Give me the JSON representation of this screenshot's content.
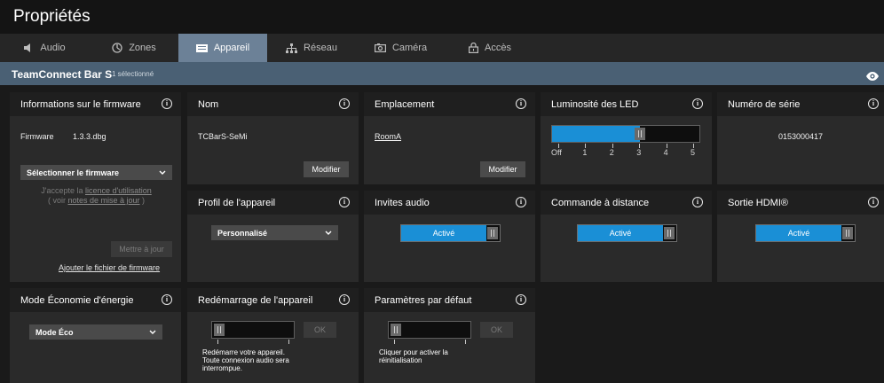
{
  "window": {
    "title": "Propriétés"
  },
  "tabs": [
    {
      "label": "Audio",
      "icon": "speaker-icon"
    },
    {
      "label": "Zones",
      "icon": "zones-icon"
    },
    {
      "label": "Appareil",
      "icon": "device-icon",
      "active": true
    },
    {
      "label": "Réseau",
      "icon": "network-icon"
    },
    {
      "label": "Caméra",
      "icon": "camera-icon"
    },
    {
      "label": "Accès",
      "icon": "lock-icon"
    }
  ],
  "device": {
    "name": "TeamConnect Bar S",
    "selected": "1 sélectionné"
  },
  "firmware": {
    "title": "Informations sur le firmware",
    "label": "Firmware",
    "version": "1.3.3.dbg",
    "select": "Sélectionner le firmware",
    "accept_prefix": "J'accepte la ",
    "accept_link": "licence d'utilisation",
    "see_prefix": "( voir ",
    "see_link": "notes de mise à jour",
    "see_suffix": " )",
    "update_button": "Mettre à jour",
    "add_file": "Ajouter le fichier de firmware"
  },
  "name_card": {
    "title": "Nom",
    "value": "TCBarS-SeMi",
    "button": "Modifier"
  },
  "location_card": {
    "title": "Emplacement",
    "value": "RoomA",
    "button": "Modifier"
  },
  "led": {
    "title": "Luminosité des LED",
    "level": 3,
    "max": 5,
    "ticks": [
      "Off",
      "1",
      "2",
      "3",
      "4",
      "5"
    ]
  },
  "serial": {
    "title": "Numéro de série",
    "value": "0153000417"
  },
  "profile": {
    "title": "Profil de l'appareil",
    "value": "Personnalisé"
  },
  "audio_prompts": {
    "title": "Invites audio",
    "state": "Activé"
  },
  "remote": {
    "title": "Commande à distance",
    "state": "Activé"
  },
  "hdmi": {
    "title": "Sortie HDMI®",
    "state": "Activé"
  },
  "eco": {
    "title": "Mode Économie d'énergie",
    "value": "Mode Éco"
  },
  "restart": {
    "title": "Redémarrage de l'appareil",
    "button": "OK",
    "line1": "Redémarre votre appareil.",
    "line2": "Toute connexion audio sera",
    "line3": "interrompue."
  },
  "defaults": {
    "title": "Paramètres par défaut",
    "button": "OK",
    "line1": "Cliquer pour activer la",
    "line2": "réinitialisation"
  },
  "colors": {
    "accent": "#1a8fd6",
    "active_tab": "#6c8197",
    "subbar": "#4a6074",
    "card": "#2a2a2a"
  }
}
